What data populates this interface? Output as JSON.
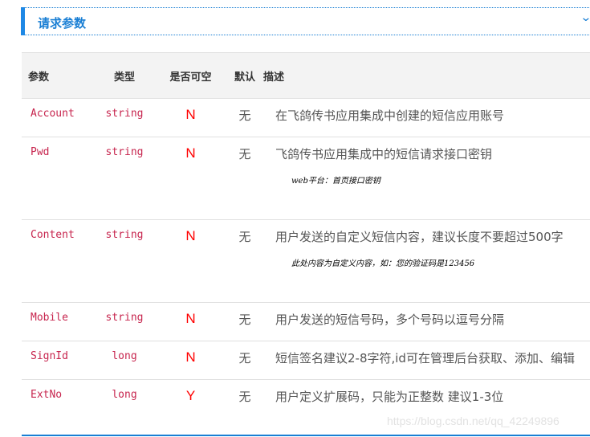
{
  "section": {
    "title": "请求参数",
    "toggle_icon": "chevron-down-icon",
    "accent_color": "#1a7fd4"
  },
  "table": {
    "headers": [
      "参数",
      "类型",
      "是否可空",
      "默认",
      "描述"
    ],
    "rows": [
      {
        "name": "Account",
        "type": "string",
        "nullable": "N",
        "default": "无",
        "desc": "在飞鸽传书应用集成中创建的短信应用账号",
        "note": ""
      },
      {
        "name": "Pwd",
        "type": "string",
        "nullable": "N",
        "default": "无",
        "desc": "飞鸽传书应用集成中的短信请求接口密钥",
        "note": "web平台：首页接口密钥"
      },
      {
        "name": "Content",
        "type": "string",
        "nullable": "N",
        "default": "无",
        "desc": "用户发送的自定义短信内容，建议长度不要超过500字",
        "note": "此处内容为自定义内容，如：您的验证码是123456"
      },
      {
        "name": "Mobile",
        "type": "string",
        "nullable": "N",
        "default": "无",
        "desc": "用户发送的短信号码，多个号码以逗号分隔",
        "note": ""
      },
      {
        "name": "SignId",
        "type": "long",
        "nullable": "N",
        "default": "无",
        "desc": "短信签名建议2-8字符,id可在管理后台获取、添加、编辑",
        "note": ""
      },
      {
        "name": "ExtNo",
        "type": "long",
        "nullable": "Y",
        "default": "无",
        "desc": "用户定义扩展码，只能为正整数 建议1-3位",
        "note": ""
      }
    ]
  },
  "watermark": "https://blog.csdn.net/qq_42249896"
}
